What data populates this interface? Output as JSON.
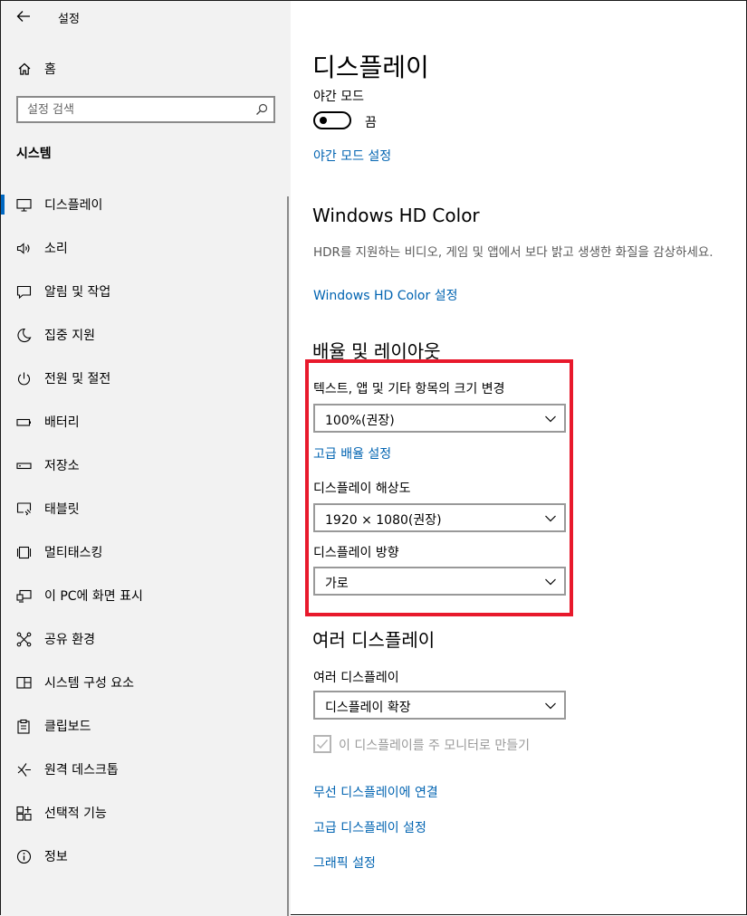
{
  "app": {
    "title": "설정"
  },
  "home": {
    "label": "홈"
  },
  "search": {
    "placeholder": "설정 검색"
  },
  "sidebar": {
    "section": "시스템",
    "items": [
      {
        "label": "디스플레이",
        "icon": "monitor-icon",
        "selected": true
      },
      {
        "label": "소리",
        "icon": "speaker-icon"
      },
      {
        "label": "알림 및 작업",
        "icon": "notification-icon"
      },
      {
        "label": "집중 지원",
        "icon": "moon-icon"
      },
      {
        "label": "전원 및 절전",
        "icon": "power-icon"
      },
      {
        "label": "배터리",
        "icon": "battery-icon"
      },
      {
        "label": "저장소",
        "icon": "storage-icon"
      },
      {
        "label": "태블릿",
        "icon": "tablet-icon"
      },
      {
        "label": "멀티태스킹",
        "icon": "multitasking-icon"
      },
      {
        "label": "이 PC에 화면 표시",
        "icon": "project-icon"
      },
      {
        "label": "공유 환경",
        "icon": "shared-experience-icon"
      },
      {
        "label": "시스템 구성 요소",
        "icon": "system-components-icon"
      },
      {
        "label": "클립보드",
        "icon": "clipboard-icon"
      },
      {
        "label": "원격 데스크톱",
        "icon": "remote-desktop-icon"
      },
      {
        "label": "선택적 기능",
        "icon": "optional-features-icon"
      },
      {
        "label": "정보",
        "icon": "info-icon"
      }
    ]
  },
  "main": {
    "title": "디스플레이",
    "night_light": {
      "label": "야간 모드",
      "toggle_state": "끔",
      "settings_link": "야간 모드 설정"
    },
    "hdr": {
      "heading": "Windows HD Color",
      "description": "HDR를 지원하는 비디오, 게임 및 앱에서 보다 밝고 생생한 화질을 감상하세요.",
      "link": "Windows HD Color 설정"
    },
    "scale_layout": {
      "heading": "배율 및 레이아웃",
      "scale_label": "텍스트, 앱 및 기타 항목의 크기 변경",
      "scale_value": "100%(권장)",
      "advanced_scaling_link": "고급 배율 설정",
      "resolution_label": "디스플레이 해상도",
      "resolution_value": "1920 × 1080(권장)",
      "orientation_label": "디스플레이 방향",
      "orientation_value": "가로"
    },
    "multiple_displays": {
      "heading": "여러 디스플레이",
      "label": "여러 디스플레이",
      "value": "디스플레이 확장",
      "checkbox_label": "이 디스플레이를 주 모니터로 만들기",
      "links": [
        "무선 디스플레이에 연결",
        "고급 디스플레이 설정",
        "그래픽 설정"
      ]
    }
  },
  "colors": {
    "accent": "#0067c0",
    "link": "#0063b1",
    "highlight": "#e8192c"
  }
}
